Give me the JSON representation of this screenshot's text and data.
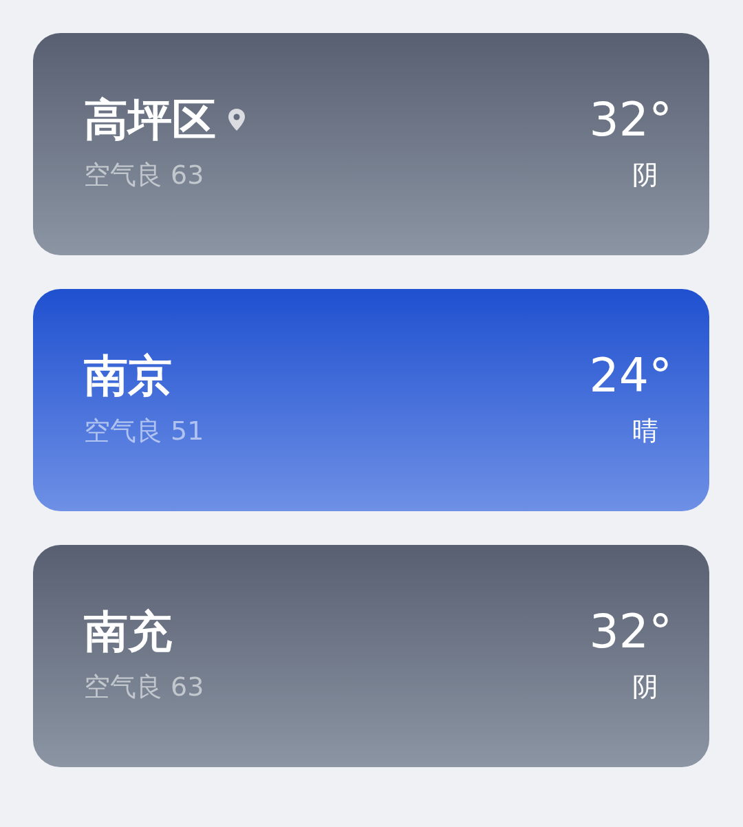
{
  "cities": [
    {
      "name": "高坪区",
      "current_location": true,
      "kind": "cloudy",
      "temperature": "32°",
      "air_quality": "空气良 63",
      "weather": "阴"
    },
    {
      "name": "南京",
      "current_location": false,
      "kind": "sunny",
      "temperature": "24°",
      "air_quality": "空气良 51",
      "weather": "晴"
    },
    {
      "name": "南充",
      "current_location": false,
      "kind": "cloudy",
      "temperature": "32°",
      "air_quality": "空气良 63",
      "weather": "阴"
    }
  ]
}
